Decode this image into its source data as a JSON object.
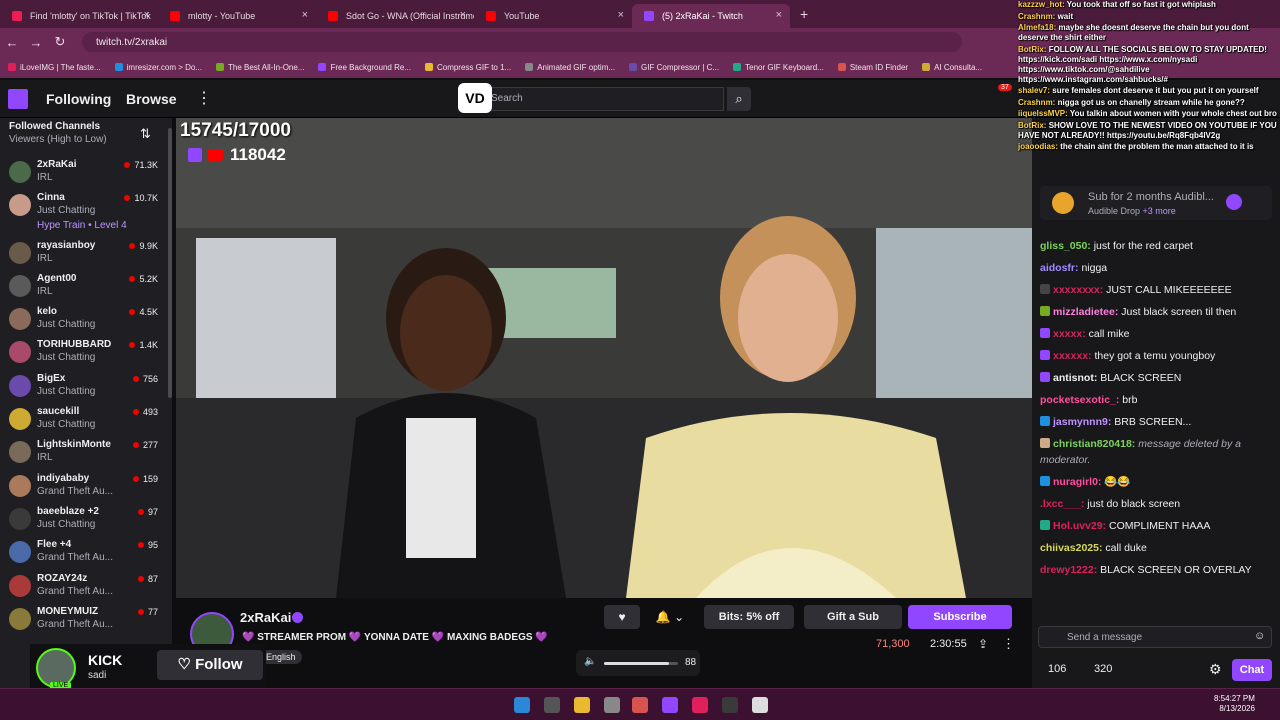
{
  "browser": {
    "tabs": [
      {
        "label": "Find 'mlotty' on TikTok | TikTok",
        "color": "#ee1d52"
      },
      {
        "label": "mlotty - YouTube",
        "color": "#ff0000"
      },
      {
        "label": "Sdot Go - WNA (Official Instrumental)",
        "color": "#ff0000"
      },
      {
        "label": "YouTube",
        "color": "#ff0000"
      },
      {
        "label": "(5) 2xRaKai - Twitch",
        "color": "#9147ff"
      }
    ],
    "url": "twitch.tv/2xrakai",
    "bookmarks": [
      "iLoveIMG | The faste...",
      "imresizer.com > Do...",
      "The Best All-In-One...",
      "Free Background Re...",
      "Compress GIF to 1...",
      "Animated GIF optim...",
      "GIF Compressor | C...",
      "Tenor GIF Keyboard...",
      "Steam ID Finder",
      "AI Consulta..."
    ]
  },
  "topnav": {
    "following": "Following",
    "browse": "Browse",
    "search_placeholder": "Search",
    "vd_badge": "VD",
    "notifications": "37"
  },
  "sidebar": {
    "heading": "Followed Channels",
    "subheading": "Viewers (High to Low)",
    "hype_train": "Hype Train • Level 4",
    "channels": [
      {
        "name": "2xRaKai",
        "category": "IRL",
        "viewers": "71.3K",
        "color": "#4a6a4a"
      },
      {
        "name": "Cinna",
        "category": "Just Chatting",
        "viewers": "10.7K",
        "color": "#c89a88"
      },
      {
        "name": "rayasianboy",
        "category": "IRL",
        "viewers": "9.9K",
        "color": "#6a5a4a"
      },
      {
        "name": "Agent00",
        "category": "IRL",
        "viewers": "5.2K",
        "color": "#5a5a5a"
      },
      {
        "name": "kelo",
        "category": "Just Chatting",
        "viewers": "4.5K",
        "color": "#8a6a5a"
      },
      {
        "name": "TORIHUBBARD",
        "category": "Just Chatting",
        "viewers": "1.4K",
        "color": "#aa4a6a"
      },
      {
        "name": "BigEx",
        "category": "Just Chatting",
        "viewers": "756",
        "color": "#6a4aaa"
      },
      {
        "name": "saucekill",
        "category": "Just Chatting",
        "viewers": "493",
        "color": "#ccaa33"
      },
      {
        "name": "LightskinMonte",
        "category": "IRL",
        "viewers": "277",
        "color": "#7a6a5a"
      },
      {
        "name": "indiyababy",
        "category": "Grand Theft Au...",
        "viewers": "159",
        "color": "#aa7a5a"
      },
      {
        "name": "baeeblaze +2",
        "category": "Just Chatting",
        "viewers": "97",
        "color": "#3a3a3a"
      },
      {
        "name": "Flee +4",
        "category": "Grand Theft Au...",
        "viewers": "95",
        "color": "#4a6aaa"
      },
      {
        "name": "ROZAY24z",
        "category": "Grand Theft Au...",
        "viewers": "87",
        "color": "#aa3a3a"
      },
      {
        "name": "MONEYMUIZ",
        "category": "Grand Theft Au...",
        "viewers": "77",
        "color": "#8a7a3a"
      }
    ]
  },
  "video": {
    "goal": "15745/17000",
    "subs": "118042"
  },
  "stream": {
    "name": "2xRaKai",
    "title": "💜 STREAMER PROM 💜 YONNA DATE 💜 MAXING BADEGS 💜",
    "language": "English",
    "bits": "Bits: 5% off",
    "gift": "Gift a Sub",
    "subscribe": "Subscribe",
    "viewers": "71,300",
    "uptime": "2:30:55",
    "volume": "88",
    "volume_fraction": 0.88
  },
  "kick": {
    "title": "KICK",
    "user": "sadi",
    "live": "LIVE",
    "follow": "Follow"
  },
  "overlay_chat": [
    {
      "user": "kazzzw_hot:",
      "text": "You took that off so fast it got whiplash"
    },
    {
      "user": "Crashnm:",
      "text": "wait"
    },
    {
      "user": "Almefa18:",
      "text": "maybe she doesnt deserve the chain but you dont deserve the shirt either"
    },
    {
      "user": "BotRix:",
      "text": "FOLLOW ALL THE SOCIALS BELOW TO STAY UPDATED! https://kick.com/sadi https://www.x.com/nysadi https://www.tiktok.com/@sahdilive https://www.instagram.com/sahbucks/#"
    },
    {
      "user": "shalev7:",
      "text": "sure females dont deserve it but you put it on yourself"
    },
    {
      "user": "Crashnm:",
      "text": "nigga got us on chanelly stream while he gone??"
    },
    {
      "user": "iiquelssMVP:",
      "text": "You talkin about women with your whole chest out bro"
    },
    {
      "user": "BotRix:",
      "text": "SHOW LOVE TO THE NEWEST VIDEO ON YOUTUBE IF YOU HAVE NOT ALREADY!! https://youtu.be/Rq8Fqb4lV2g"
    },
    {
      "user": "joaoodias:",
      "text": "the chain aint the problem the man attached to it is"
    }
  ],
  "drop": {
    "sub": "Sub for 2 months Audibl...",
    "name": "Audible Drop",
    "more": "+3 more"
  },
  "chat": {
    "messages": [
      {
        "user": "gliss_050:",
        "text": "just for the red carpet",
        "color": "#7fd15c",
        "badge": "",
        "deleted": false
      },
      {
        "user": "aidosfr:",
        "text": "nigga",
        "color": "#a58aff",
        "badge": "",
        "deleted": false
      },
      {
        "user": "xxxxxxxx:",
        "text": "JUST CALL MIKEEEEEEE",
        "color": "#e0205a",
        "badge": "#444",
        "deleted": false
      },
      {
        "user": "mizzladietee:",
        "text": "Just black screen til then",
        "color": "#ff7fdc",
        "badge": "#7a2",
        "deleted": false
      },
      {
        "user": "xxxxx:",
        "text": "call mike",
        "color": "#e0205a",
        "badge": "#9147ff",
        "deleted": false
      },
      {
        "user": "xxxxxx:",
        "text": "they got a temu youngboy",
        "color": "#e0205a",
        "badge": "#9147ff",
        "deleted": false
      },
      {
        "user": "antisnot:",
        "text": "BLACK SCREEN",
        "color": "#efeff1",
        "badge": "#9147ff",
        "deleted": false
      },
      {
        "user": "pocketsexotic_:",
        "text": "brb",
        "color": "#ff4fa0",
        "badge": "",
        "deleted": false
      },
      {
        "user": "jasmynnn9:",
        "text": "BRB SCREEN...",
        "color": "#bf94ff",
        "badge": "#1f8fe0",
        "deleted": false
      },
      {
        "user": "christian820418:",
        "text": "message deleted by a moderator.",
        "color": "#7fd15c",
        "badge": "#ca8",
        "deleted": true
      },
      {
        "user": "nuragirl0:",
        "text": "😂😂",
        "color": "#ff4fa0",
        "badge": "#1f8fe0",
        "deleted": false
      },
      {
        "user": ".lxcc___:",
        "text": "just do black screen",
        "color": "#e0205a",
        "badge": "",
        "deleted": false
      },
      {
        "user": "Hol.uvv29:",
        "text": "COMPLIMENT HAAA",
        "color": "#e0205a",
        "badge": "#2a8",
        "deleted": false
      },
      {
        "user": "chiivas2025:",
        "text": "call duke",
        "color": "#d8d85a",
        "badge": "",
        "deleted": false
      },
      {
        "user": "drewy1222:",
        "text": "BLACK SCREEN OR OVERLAY",
        "color": "#e0205a",
        "badge": "",
        "deleted": false
      }
    ],
    "input_placeholder": "Send a message",
    "bits_count": "106",
    "points": "320",
    "chat_button": "Chat"
  },
  "taskbar": {
    "time": "8:54:27 PM",
    "date": "8/13/2026"
  },
  "colors": {
    "twitch_purple": "#9147ff",
    "kick_green": "#53fc18",
    "live_red": "#eb0400"
  }
}
